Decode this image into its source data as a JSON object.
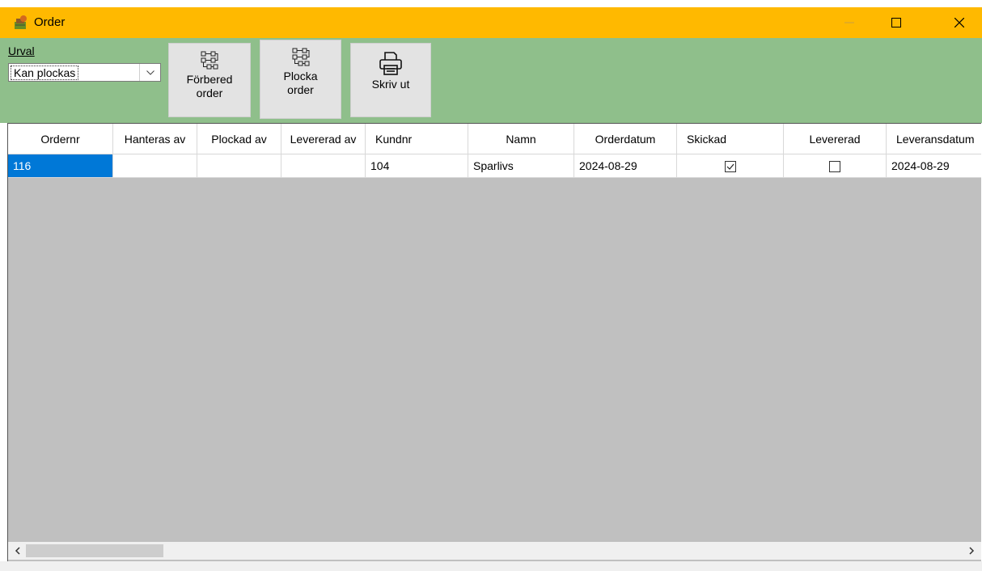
{
  "window": {
    "title": "Order",
    "accent": "#ffb900",
    "toolbar_bg": "#8fbf8b",
    "controls": [
      "minimize-icon",
      "maximize-icon",
      "close-icon"
    ]
  },
  "toolbar": {
    "urval_label": "Urval",
    "urval_value": "Kan plockas",
    "buttons": [
      {
        "line1": "Förbered",
        "line2": "order",
        "icon": "workflow-icon"
      },
      {
        "line1": "Plocka",
        "line2": "order",
        "icon": "workflow-icon"
      },
      {
        "line1": "Skriv ut",
        "line2": "",
        "icon": "printer-icon"
      }
    ]
  },
  "table": {
    "columns": [
      "Ordernr",
      "Hanteras av",
      "Plockad av",
      "Levererad av",
      "Kundnr",
      "Namn",
      "Orderdatum",
      "Skickad",
      "Levererad",
      "Leveransdatum"
    ],
    "rows": [
      {
        "ordernr": "116",
        "hanteras_av": "",
        "plockad_av": "",
        "levererad_av": "",
        "kundnr": "104",
        "namn": "Sparlivs",
        "orderdatum": "2024-08-29",
        "skickad": true,
        "levererad": false,
        "leveransdatum": "2024-08-29"
      }
    ],
    "selection_color": "#0078d7"
  }
}
